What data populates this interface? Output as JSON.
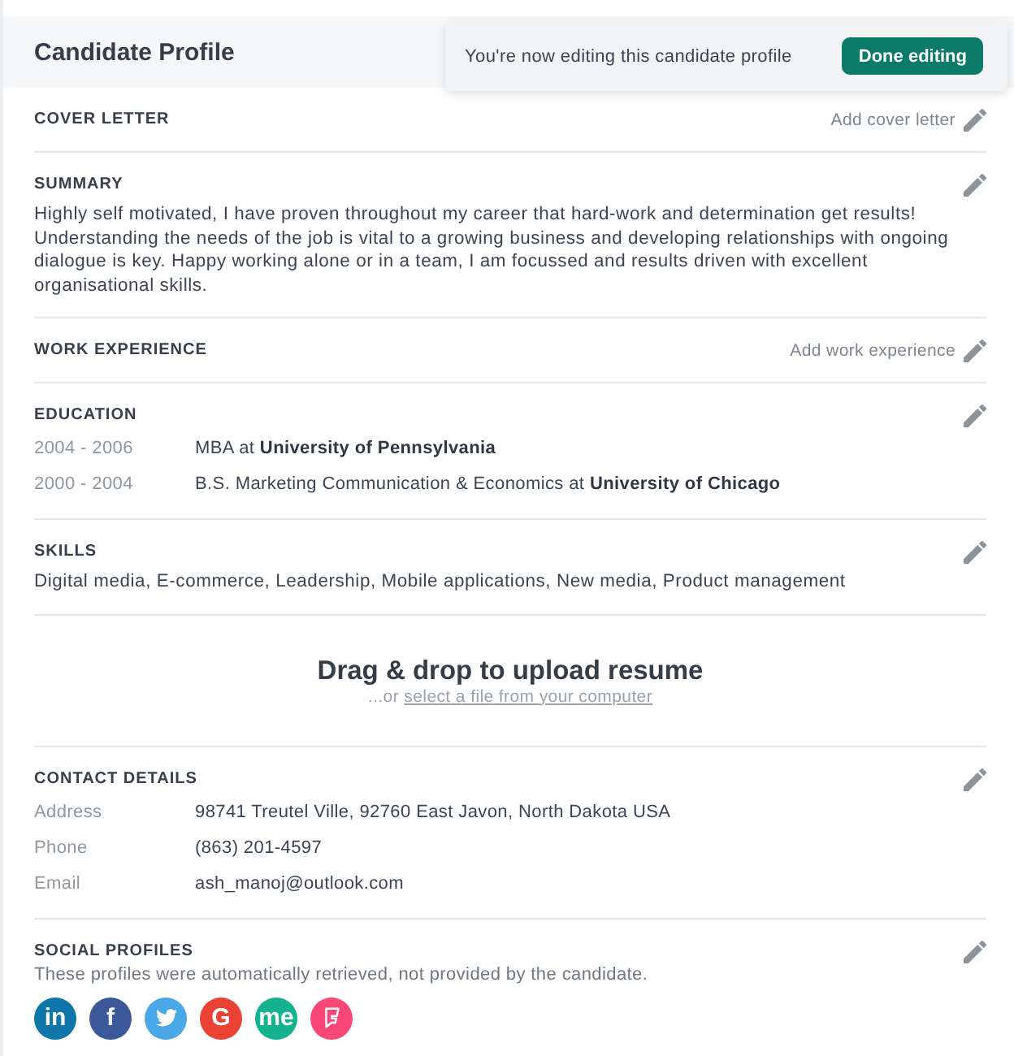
{
  "header": {
    "title": "Candidate Profile"
  },
  "toast": {
    "message": "You're now editing this candidate profile",
    "button": "Done editing"
  },
  "sections": [
    {
      "kind": "action",
      "title": "COVER LETTER",
      "action": "Add cover letter"
    },
    {
      "kind": "text",
      "title": "SUMMARY",
      "text": "Highly self motivated, I have proven throughout my career that hard-work and determination get results! Understanding the needs of the job is vital to a growing business and developing relationships with ongoing dialogue is key. Happy working alone or in a team, I am focussed and results driven with excellent organisational skills."
    },
    {
      "kind": "action",
      "title": "WORK EXPERIENCE",
      "action": "Add work experience"
    },
    {
      "kind": "education",
      "title": "EDUCATION",
      "rows": [
        {
          "years": "2004 - 2006",
          "degree": "MBA at **University of Pennsylvania**"
        },
        {
          "years": "2000 - 2004",
          "degree": "B.S. Marketing Communication & Economics at **University of Chicago**"
        }
      ]
    },
    {
      "kind": "text",
      "title": "SKILLS",
      "text": "Digital media, E-commerce, Leadership, Mobile applications, New media, Product management"
    },
    {
      "kind": "upload",
      "title": "Drag & drop to upload resume",
      "prefix": "...or",
      "link": "select a file from your computer"
    },
    {
      "kind": "details",
      "title": "CONTACT DETAILS",
      "rows": [
        {
          "label": "Address",
          "value": "98741 Treutel Ville, 92760 East Javon, North Dakota USA"
        },
        {
          "label": "Phone",
          "value": "(863) 201-4597"
        },
        {
          "label": "Email",
          "value": "ash_manoj@outlook.com"
        }
      ]
    },
    {
      "kind": "social",
      "title": "SOCIAL PROFILES",
      "note": "These profiles were automatically retrieved, not provided by the candidate.",
      "profiles": [
        {
          "kind": "letters",
          "label": "in",
          "color": "#0e76a8"
        },
        {
          "kind": "letters",
          "label": "f",
          "color": "#3b5998"
        },
        {
          "kind": "bird",
          "color": "#4aa8e8"
        },
        {
          "kind": "letters",
          "label": "G",
          "color": "#ea4335"
        },
        {
          "kind": "letters",
          "label": "me",
          "color": "#15b28f"
        },
        {
          "kind": "flag",
          "color": "#f94877"
        }
      ]
    }
  ]
}
